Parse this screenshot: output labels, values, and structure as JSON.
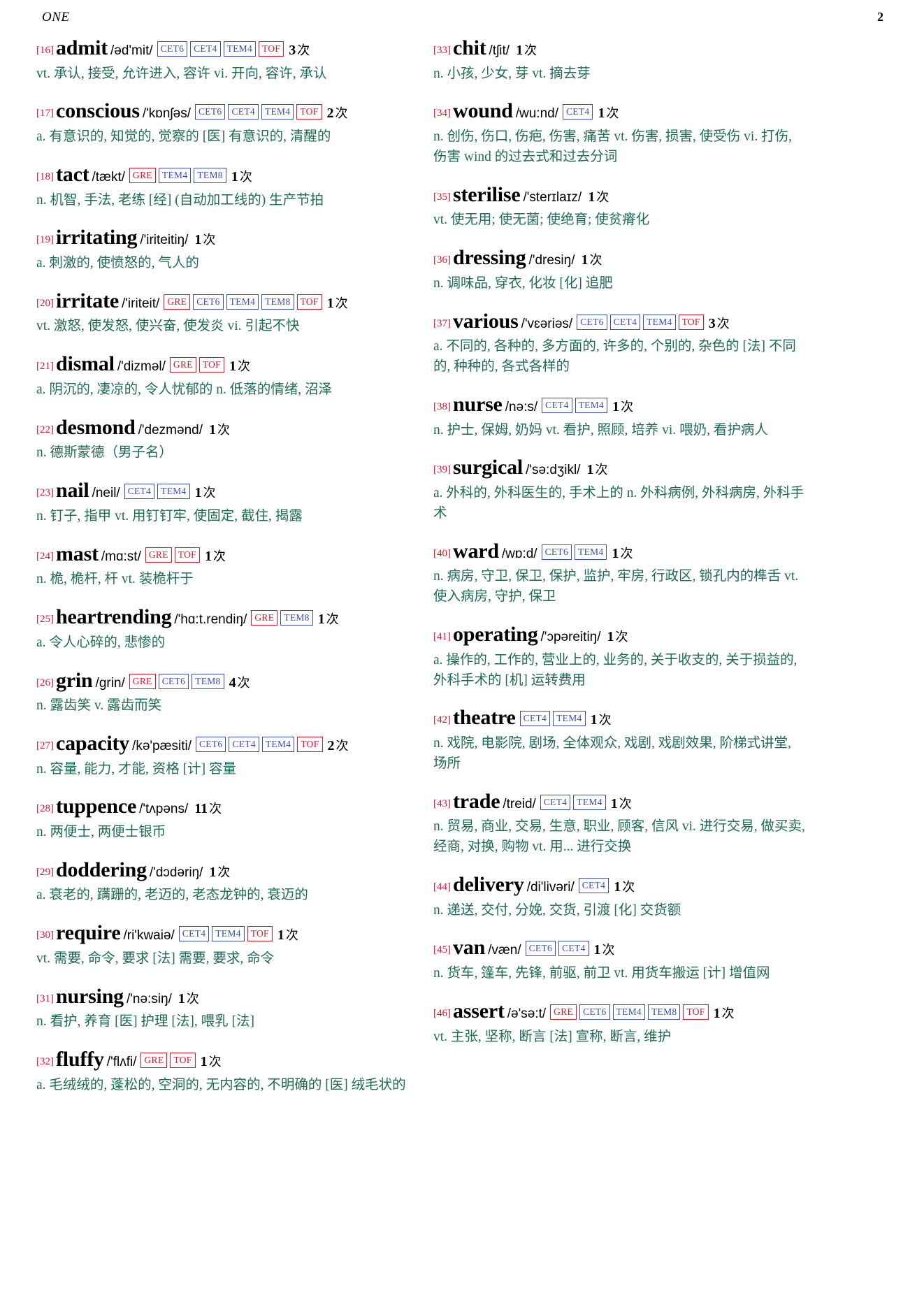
{
  "header": {
    "title": "ONE",
    "page_number": "2"
  },
  "labels": {
    "count_unit": "次"
  },
  "columns": [
    {
      "entries": [
        {
          "index": "[16]",
          "word": "admit",
          "phonetic": "/əd'mit/",
          "tags": [
            {
              "label": "CET6",
              "color": "blue"
            },
            {
              "label": "CET4",
              "color": "blue"
            },
            {
              "label": "TEM4",
              "color": "blue"
            },
            {
              "label": "TOF",
              "color": "red"
            }
          ],
          "count": "3",
          "definition": "vt. 承认, 接受, 允许进入, 容许 vi. 开向, 容许, 承认"
        },
        {
          "index": "[17]",
          "word": "conscious",
          "phonetic": "/'kɒnʃəs/",
          "tags": [
            {
              "label": "CET6",
              "color": "blue"
            },
            {
              "label": "CET4",
              "color": "blue"
            },
            {
              "label": "TEM4",
              "color": "blue"
            },
            {
              "label": "TOF",
              "color": "red"
            }
          ],
          "count": "2",
          "definition": "a. 有意识的, 知觉的, 觉察的 [医] 有意识的, 清醒的"
        },
        {
          "index": "[18]",
          "word": "tact",
          "phonetic": "/tækt/",
          "tags": [
            {
              "label": "GRE",
              "color": "red"
            },
            {
              "label": "TEM4",
              "color": "blue"
            },
            {
              "label": "TEM8",
              "color": "blue"
            }
          ],
          "count": "1",
          "definition": "n. 机智, 手法, 老练 [经] (自动加工线的) 生产节拍"
        },
        {
          "index": "[19]",
          "word": "irritating",
          "phonetic": "/'iriteitiŋ/",
          "tags": [],
          "count": "1",
          "definition": "a. 刺激的, 使愤怒的, 气人的"
        },
        {
          "index": "[20]",
          "word": "irritate",
          "phonetic": "/'iriteit/",
          "tags": [
            {
              "label": "GRE",
              "color": "red"
            },
            {
              "label": "CET6",
              "color": "blue"
            },
            {
              "label": "TEM4",
              "color": "blue"
            },
            {
              "label": "TEM8",
              "color": "blue"
            },
            {
              "label": "TOF",
              "color": "red"
            }
          ],
          "count": "1",
          "definition": "vt. 激怒, 使发怒, 使兴奋, 使发炎 vi. 引起不快"
        },
        {
          "index": "[21]",
          "word": "dismal",
          "phonetic": "/'dizməl/",
          "tags": [
            {
              "label": "GRE",
              "color": "red"
            },
            {
              "label": "TOF",
              "color": "red"
            }
          ],
          "count": "1",
          "definition": "a. 阴沉的, 凄凉的, 令人忧郁的 n. 低落的情绪, 沼泽"
        },
        {
          "index": "[22]",
          "word": "desmond",
          "phonetic": "/'dezmənd/",
          "tags": [],
          "count": "1",
          "definition": "n. 德斯蒙德（男子名）"
        },
        {
          "index": "[23]",
          "word": "nail",
          "phonetic": "/neil/",
          "tags": [
            {
              "label": "CET4",
              "color": "blue"
            },
            {
              "label": "TEM4",
              "color": "blue"
            }
          ],
          "count": "1",
          "definition": "n. 钉子, 指甲 vt. 用钉钉牢, 使固定, 截住, 揭露"
        },
        {
          "index": "[24]",
          "word": "mast",
          "phonetic": "/mɑ:st/",
          "tags": [
            {
              "label": "GRE",
              "color": "red"
            },
            {
              "label": "TOF",
              "color": "red"
            }
          ],
          "count": "1",
          "definition": "n. 桅, 桅杆, 杆 vt. 装桅杆于"
        },
        {
          "index": "[25]",
          "word": "heartrending",
          "phonetic": "/'hɑ:t.rendiŋ/",
          "tags": [
            {
              "label": "GRE",
              "color": "red"
            },
            {
              "label": "TEM8",
              "color": "blue"
            }
          ],
          "count": "1",
          "definition": "a. 令人心碎的, 悲惨的"
        },
        {
          "index": "[26]",
          "word": "grin",
          "phonetic": "/grin/",
          "tags": [
            {
              "label": "GRE",
              "color": "red"
            },
            {
              "label": "CET6",
              "color": "blue"
            },
            {
              "label": "TEM8",
              "color": "blue"
            }
          ],
          "count": "4",
          "definition": "n. 露齿笑 v. 露齿而笑"
        },
        {
          "index": "[27]",
          "word": "capacity",
          "phonetic": "/kə'pæsiti/",
          "tags": [
            {
              "label": "CET6",
              "color": "blue"
            },
            {
              "label": "CET4",
              "color": "blue"
            },
            {
              "label": "TEM4",
              "color": "blue"
            },
            {
              "label": "TOF",
              "color": "red"
            }
          ],
          "count": "2",
          "definition": "n. 容量, 能力, 才能, 资格 [计] 容量"
        },
        {
          "index": "[28]",
          "word": "tuppence",
          "phonetic": "/'tʌpəns/",
          "tags": [],
          "count": "11",
          "definition": "n. 两便士, 两便士银币"
        },
        {
          "index": "[29]",
          "word": "doddering",
          "phonetic": "/'dɔdəriŋ/",
          "tags": [],
          "count": "1",
          "definition": "a. 衰老的, 蹒跚的, 老迈的, 老态龙钟的, 衰迈的"
        },
        {
          "index": "[30]",
          "word": "require",
          "phonetic": "/ri'kwaiə/",
          "tags": [
            {
              "label": "CET4",
              "color": "blue"
            },
            {
              "label": "TEM4",
              "color": "blue"
            },
            {
              "label": "TOF",
              "color": "red"
            }
          ],
          "count": "1",
          "definition": "vt. 需要, 命令, 要求 [法] 需要, 要求, 命令"
        },
        {
          "index": "[31]",
          "word": "nursing",
          "phonetic": "/'nə:siŋ/",
          "tags": [],
          "count": "1",
          "definition": "n. 看护, 养育 [医] 护理 [法], 喂乳 [法]"
        },
        {
          "index": "[32]",
          "word": "fluffy",
          "phonetic": "/'flʌfi/",
          "tags": [
            {
              "label": "GRE",
              "color": "red"
            },
            {
              "label": "TOF",
              "color": "red"
            }
          ],
          "count": "1",
          "definition": "a. 毛绒绒的, 蓬松的, 空洞的, 无内容的, 不明确的 [医] 绒毛状的"
        }
      ]
    },
    {
      "entries": [
        {
          "index": "[33]",
          "word": "chit",
          "phonetic": "/tʃit/",
          "tags": [],
          "count": "1",
          "definition": "n. 小孩, 少女, 芽 vt. 摘去芽"
        },
        {
          "index": "[34]",
          "word": "wound",
          "phonetic": "/wu:nd/",
          "tags": [
            {
              "label": "CET4",
              "color": "blue"
            }
          ],
          "count": "1",
          "definition": "n. 创伤, 伤口, 伤疤, 伤害, 痛苦 vt. 伤害, 损害, 使受伤 vi. 打伤, 伤害 wind 的过去式和过去分词"
        },
        {
          "index": "[35]",
          "word": "sterilise",
          "phonetic": "/'sterɪlaɪz/",
          "tags": [],
          "count": "1",
          "definition": "vt. 使无用; 使无菌; 使绝育; 使贫瘠化"
        },
        {
          "index": "[36]",
          "word": "dressing",
          "phonetic": "/'dresiŋ/",
          "tags": [],
          "count": "1",
          "definition": "n. 调味品, 穿衣, 化妆 [化] 追肥"
        },
        {
          "index": "[37]",
          "word": "various",
          "phonetic": "/'vɛəriəs/",
          "tags": [
            {
              "label": "CET6",
              "color": "blue"
            },
            {
              "label": "CET4",
              "color": "blue"
            },
            {
              "label": "TEM4",
              "color": "blue"
            },
            {
              "label": "TOF",
              "color": "red"
            }
          ],
          "count": "3",
          "definition": "a. 不同的, 各种的, 多方面的, 许多的, 个别的, 杂色的 [法] 不同的, 种种的, 各式各样的"
        },
        {
          "index": "[38]",
          "word": "nurse",
          "phonetic": "/nə:s/",
          "tags": [
            {
              "label": "CET4",
              "color": "blue"
            },
            {
              "label": "TEM4",
              "color": "blue"
            }
          ],
          "count": "1",
          "definition": "n. 护士, 保姆, 奶妈 vt. 看护, 照顾, 培养 vi. 喂奶, 看护病人"
        },
        {
          "index": "[39]",
          "word": "surgical",
          "phonetic": "/'sə:dʒikl/",
          "tags": [],
          "count": "1",
          "definition": "a. 外科的, 外科医生的, 手术上的 n. 外科病例, 外科病房, 外科手术"
        },
        {
          "index": "[40]",
          "word": "ward",
          "phonetic": "/wɒ:d/",
          "tags": [
            {
              "label": "CET6",
              "color": "blue"
            },
            {
              "label": "TEM4",
              "color": "blue"
            }
          ],
          "count": "1",
          "definition": "n. 病房, 守卫, 保卫, 保护, 监护, 牢房, 行政区, 锁孔内的榫舌 vt. 使入病房, 守护, 保卫"
        },
        {
          "index": "[41]",
          "word": "operating",
          "phonetic": "/'ɔpəreitiŋ/",
          "tags": [],
          "count": "1",
          "definition": "a. 操作的, 工作的, 营业上的, 业务的, 关于收支的, 关于损益的, 外科手术的 [机] 运转费用"
        },
        {
          "index": "[42]",
          "word": "theatre",
          "phonetic": "",
          "tags": [
            {
              "label": "CET4",
              "color": "blue"
            },
            {
              "label": "TEM4",
              "color": "blue"
            }
          ],
          "count": "1",
          "definition": "n. 戏院, 电影院, 剧场, 全体观众, 戏剧, 戏剧效果, 阶梯式讲堂, 场所"
        },
        {
          "index": "[43]",
          "word": "trade",
          "phonetic": "/treid/",
          "tags": [
            {
              "label": "CET4",
              "color": "blue"
            },
            {
              "label": "TEM4",
              "color": "blue"
            }
          ],
          "count": "1",
          "definition": "n. 贸易, 商业, 交易, 生意, 职业, 顾客, 信风 vi. 进行交易, 做买卖, 经商, 对换, 购物 vt. 用... 进行交换"
        },
        {
          "index": "[44]",
          "word": "delivery",
          "phonetic": "/di'livəri/",
          "tags": [
            {
              "label": "CET4",
              "color": "blue"
            }
          ],
          "count": "1",
          "definition": "n. 递送, 交付, 分娩, 交货, 引渡 [化] 交货额"
        },
        {
          "index": "[45]",
          "word": "van",
          "phonetic": "/væn/",
          "tags": [
            {
              "label": "CET6",
              "color": "blue"
            },
            {
              "label": "CET4",
              "color": "blue"
            }
          ],
          "count": "1",
          "definition": "n. 货车, 篷车, 先锋, 前驱, 前卫 vt. 用货车搬运 [计] 增值网"
        },
        {
          "index": "[46]",
          "word": "assert",
          "phonetic": "/ə'sə:t/",
          "tags": [
            {
              "label": "GRE",
              "color": "red"
            },
            {
              "label": "CET6",
              "color": "blue"
            },
            {
              "label": "TEM4",
              "color": "blue"
            },
            {
              "label": "TEM8",
              "color": "blue"
            },
            {
              "label": "TOF",
              "color": "red"
            }
          ],
          "count": "1",
          "definition": "vt. 主张, 坚称, 断言 [法] 宣称, 断言, 维护"
        }
      ]
    }
  ]
}
